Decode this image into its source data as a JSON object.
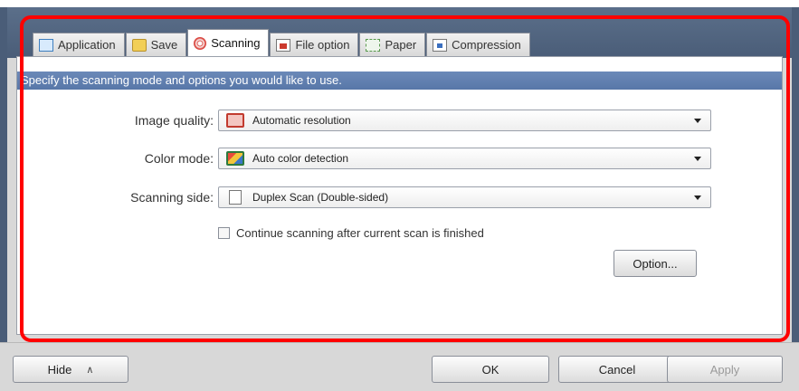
{
  "tabs": [
    {
      "label": "Application",
      "icon": "application-icon"
    },
    {
      "label": "Save",
      "icon": "save-icon"
    },
    {
      "label": "Scanning",
      "icon": "scanning-icon",
      "active": true
    },
    {
      "label": "File option",
      "icon": "file-option-icon"
    },
    {
      "label": "Paper",
      "icon": "paper-icon"
    },
    {
      "label": "Compression",
      "icon": "compression-icon"
    }
  ],
  "instruction": "Specify the scanning mode and options you would like to use.",
  "fields": {
    "image_quality": {
      "label": "Image quality:",
      "value": "Automatic resolution"
    },
    "color_mode": {
      "label": "Color mode:",
      "value": "Auto color detection"
    },
    "scanning_side": {
      "label": "Scanning side:",
      "value": "Duplex Scan (Double-sided)"
    }
  },
  "continue_scanning": {
    "label": "Continue scanning after current scan is finished",
    "checked": false
  },
  "buttons": {
    "option": "Option...",
    "hide": "Hide",
    "ok": "OK",
    "cancel": "Cancel",
    "apply": "Apply"
  },
  "colors": {
    "highlight": "#ff0000",
    "instruction_bar": "#5f7fb0",
    "header": "#4a5d78"
  }
}
